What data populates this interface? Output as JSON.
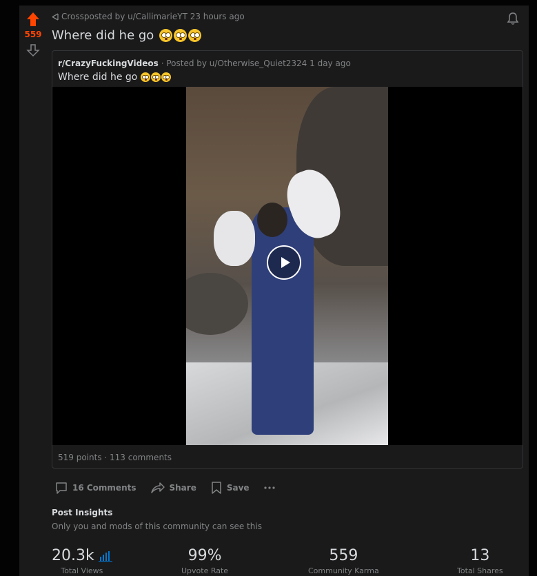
{
  "post": {
    "score": "559",
    "crosspost_label": "Crossposted by u/CallimarieYT 23 hours ago",
    "title": "Where did he go",
    "title_emoji": [
      "flushed-face",
      "flushed-face",
      "flushed-face"
    ]
  },
  "embed": {
    "subreddit": "r/CrazyFuckingVideos",
    "posted_by": "· Posted by u/Otherwise_Quiet2324 1 day ago",
    "title": "Where did he go",
    "footer": "519 points · 113 comments"
  },
  "actions": {
    "comments": "16 Comments",
    "share": "Share",
    "save": "Save"
  },
  "insights": {
    "title": "Post Insights",
    "subtitle": "Only you and mods of this community can see this",
    "stats": [
      {
        "value": "20.3k",
        "label": "Total Views"
      },
      {
        "value": "99%",
        "label": "Upvote Rate"
      },
      {
        "value": "559",
        "label": "Community Karma"
      },
      {
        "value": "13",
        "label": "Total Shares"
      }
    ]
  },
  "colors": {
    "accent": "#ff4500",
    "background": "#1a1a1b",
    "muted_text": "#818384"
  }
}
